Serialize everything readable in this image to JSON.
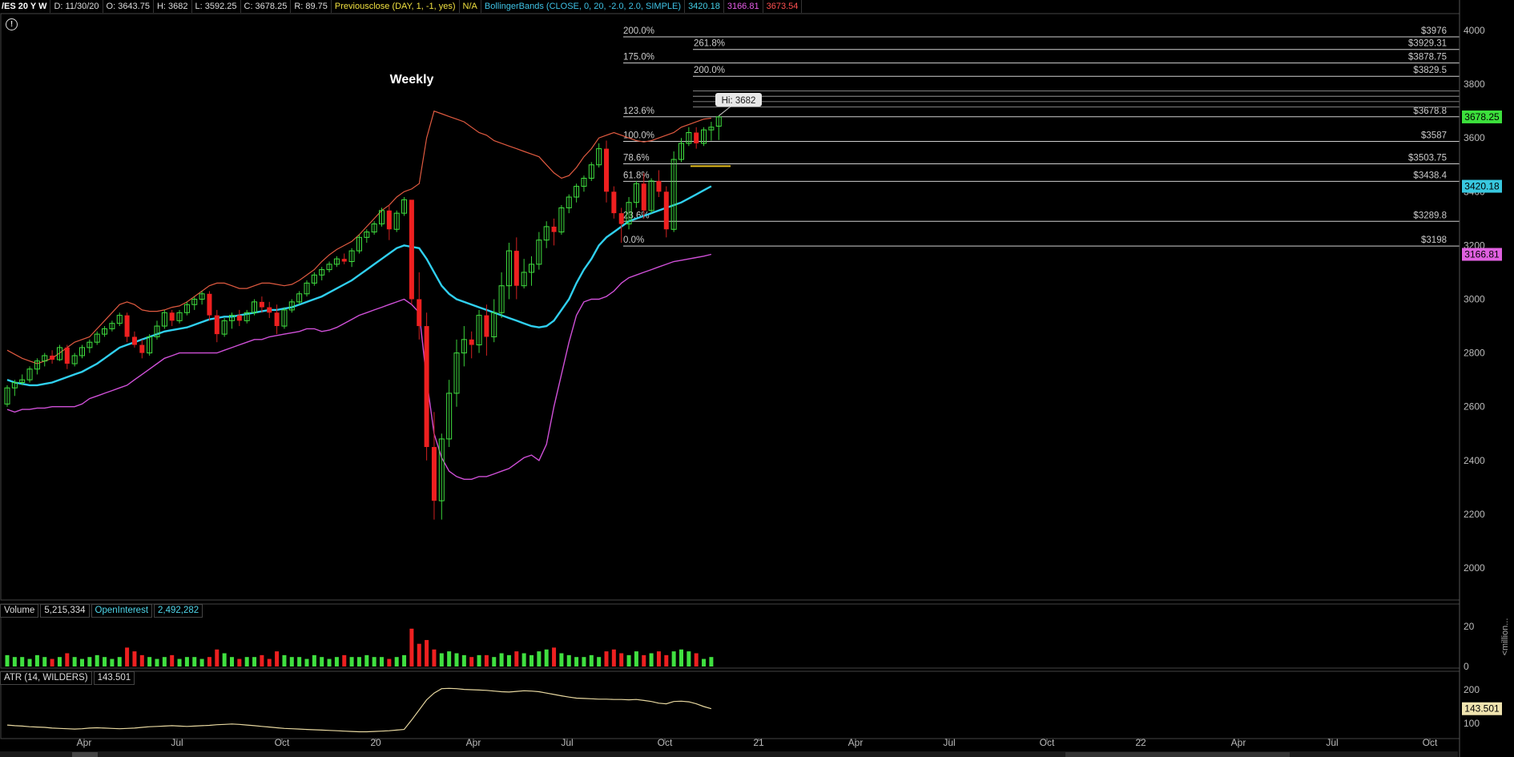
{
  "header": {
    "symbol": "/ES 20 Y W",
    "date": "D: 11/30/20",
    "open": "O: 3643.75",
    "high": "H: 3682",
    "low": "L: 3592.25",
    "close": "C: 3678.25",
    "range": "R: 89.75",
    "prevclose_label": "Previousclose (DAY, 1, -1, yes)",
    "prevclose_value": "N/A",
    "bb_label": "BollingerBands (CLOSE, 0, 20, -2.0, 2.0, SIMPLE)",
    "bb_mid": "3420.18",
    "bb_low": "3166.81",
    "bb_up": "3673.54"
  },
  "annotation": "Weekly",
  "hi_label": "Hi: 3682",
  "price_axis": {
    "ticks": [
      "4000",
      "3800",
      "3600",
      "3400",
      "3200",
      "3000",
      "2800",
      "2600",
      "2400",
      "2200",
      "2000"
    ],
    "tick_values": [
      4000,
      3800,
      3600,
      3400,
      3200,
      3000,
      2800,
      2600,
      2400,
      2200,
      2000
    ],
    "badges": [
      {
        "text": "3678.25",
        "value": 3678.25,
        "bg": "#3ce03c",
        "fg": "#000"
      },
      {
        "text": "3420.18",
        "value": 3420.18,
        "bg": "#38c8e0",
        "fg": "#000"
      },
      {
        "text": "3166.81",
        "value": 3166.81,
        "bg": "#e060e0",
        "fg": "#000"
      }
    ]
  },
  "time_axis": {
    "labels": [
      "Apr",
      "Jul",
      "Oct",
      "20",
      "Apr",
      "Jul",
      "Oct",
      "21",
      "Apr",
      "Jul",
      "Oct",
      "22",
      "Apr",
      "Jul",
      "Oct"
    ]
  },
  "fib_levels": [
    {
      "pct": "200.0%",
      "price": "$3976",
      "value": 3976,
      "set": "A"
    },
    {
      "pct": "261.8%",
      "price": "$3929.31",
      "value": 3929.31,
      "set": "B"
    },
    {
      "pct": "175.0%",
      "price": "$3878.75",
      "value": 3878.75,
      "set": "A"
    },
    {
      "pct": "200.0%",
      "price": "$3829.5",
      "value": 3829.5,
      "set": "B"
    },
    {
      "pct": "123.6%",
      "price": "$3678.8",
      "value": 3678.8,
      "set": "A"
    },
    {
      "pct": "100.0%",
      "price": "$3587",
      "value": 3587,
      "set": "A"
    },
    {
      "pct": "78.6%",
      "price": "$3503.75",
      "value": 3503.75,
      "set": "A"
    },
    {
      "pct": "61.8%",
      "price": "$3438.4",
      "value": 3438.4,
      "set": "A"
    },
    {
      "pct": "23.6%",
      "price": "$3289.8",
      "value": 3289.8,
      "set": "A"
    },
    {
      "pct": "0.0%",
      "price": "$3198",
      "value": 3198,
      "set": "A"
    }
  ],
  "volume_panel": {
    "label": "Volume",
    "value": "5,215,334",
    "oi_label": "OpenInterest",
    "oi_value": "2,492,282",
    "axis_ticks": [
      "20",
      "0"
    ],
    "axis_title": "<million..."
  },
  "atr_panel": {
    "label": "ATR (14, WILDERS)",
    "value": "143.501",
    "axis_ticks": [
      "200",
      "100"
    ],
    "badge": "143.501"
  },
  "chart_data": {
    "type": "candlestick",
    "title": "Weekly",
    "ylim": [
      1850,
      4050
    ],
    "x_weeks_start": "2019-01-07",
    "series_candles": [
      [
        2610,
        2680,
        2600,
        2670
      ],
      [
        2670,
        2700,
        2640,
        2690
      ],
      [
        2690,
        2720,
        2680,
        2700
      ],
      [
        2700,
        2750,
        2690,
        2740
      ],
      [
        2740,
        2780,
        2720,
        2770
      ],
      [
        2770,
        2800,
        2750,
        2790
      ],
      [
        2790,
        2810,
        2760,
        2775
      ],
      [
        2775,
        2830,
        2770,
        2820
      ],
      [
        2820,
        2830,
        2740,
        2760
      ],
      [
        2760,
        2800,
        2750,
        2790
      ],
      [
        2790,
        2830,
        2780,
        2820
      ],
      [
        2820,
        2850,
        2800,
        2840
      ],
      [
        2840,
        2880,
        2830,
        2870
      ],
      [
        2870,
        2900,
        2860,
        2890
      ],
      [
        2890,
        2920,
        2880,
        2910
      ],
      [
        2910,
        2950,
        2900,
        2940
      ],
      [
        2940,
        2950,
        2840,
        2860
      ],
      [
        2860,
        2880,
        2820,
        2830
      ],
      [
        2830,
        2850,
        2780,
        2800
      ],
      [
        2800,
        2870,
        2790,
        2860
      ],
      [
        2860,
        2920,
        2850,
        2900
      ],
      [
        2900,
        2960,
        2890,
        2950
      ],
      [
        2950,
        2960,
        2900,
        2920
      ],
      [
        2920,
        2960,
        2910,
        2950
      ],
      [
        2950,
        2990,
        2940,
        2980
      ],
      [
        2980,
        3010,
        2960,
        3000
      ],
      [
        3000,
        3030,
        2980,
        3020
      ],
      [
        3020,
        3030,
        2920,
        2940
      ],
      [
        2940,
        2960,
        2840,
        2870
      ],
      [
        2870,
        2930,
        2860,
        2920
      ],
      [
        2920,
        2950,
        2890,
        2940
      ],
      [
        2940,
        2960,
        2900,
        2920
      ],
      [
        2920,
        2960,
        2910,
        2950
      ],
      [
        2950,
        3000,
        2940,
        2990
      ],
      [
        2990,
        3010,
        2950,
        2970
      ],
      [
        2970,
        2990,
        2930,
        2950
      ],
      [
        2950,
        2980,
        2870,
        2900
      ],
      [
        2900,
        2970,
        2890,
        2960
      ],
      [
        2960,
        3000,
        2950,
        2990
      ],
      [
        2990,
        3030,
        2980,
        3020
      ],
      [
        3020,
        3070,
        3010,
        3060
      ],
      [
        3060,
        3100,
        3050,
        3090
      ],
      [
        3090,
        3120,
        3070,
        3110
      ],
      [
        3110,
        3140,
        3100,
        3130
      ],
      [
        3130,
        3160,
        3120,
        3150
      ],
      [
        3150,
        3170,
        3130,
        3140
      ],
      [
        3140,
        3190,
        3120,
        3180
      ],
      [
        3180,
        3240,
        3170,
        3230
      ],
      [
        3230,
        3260,
        3210,
        3250
      ],
      [
        3250,
        3290,
        3240,
        3280
      ],
      [
        3280,
        3340,
        3270,
        3330
      ],
      [
        3330,
        3350,
        3220,
        3260
      ],
      [
        3260,
        3330,
        3250,
        3320
      ],
      [
        3320,
        3380,
        3310,
        3370
      ],
      [
        3370,
        3340,
        2980,
        3000
      ],
      [
        3000,
        3100,
        2850,
        2900
      ],
      [
        2900,
        2950,
        2400,
        2450
      ],
      [
        2450,
        2580,
        2180,
        2250
      ],
      [
        2250,
        2500,
        2180,
        2480
      ],
      [
        2480,
        2700,
        2450,
        2650
      ],
      [
        2650,
        2850,
        2600,
        2800
      ],
      [
        2800,
        2900,
        2750,
        2850
      ],
      [
        2850,
        2880,
        2780,
        2830
      ],
      [
        2830,
        2960,
        2800,
        2940
      ],
      [
        2940,
        2980,
        2790,
        2860
      ],
      [
        2860,
        3000,
        2840,
        2950
      ],
      [
        2950,
        3100,
        2930,
        3050
      ],
      [
        3050,
        3210,
        3000,
        3180
      ],
      [
        3180,
        3230,
        3000,
        3050
      ],
      [
        3050,
        3150,
        3040,
        3100
      ],
      [
        3100,
        3160,
        3050,
        3130
      ],
      [
        3130,
        3250,
        3110,
        3220
      ],
      [
        3220,
        3290,
        3190,
        3270
      ],
      [
        3270,
        3300,
        3200,
        3250
      ],
      [
        3250,
        3350,
        3240,
        3340
      ],
      [
        3340,
        3390,
        3320,
        3380
      ],
      [
        3380,
        3430,
        3360,
        3420
      ],
      [
        3420,
        3460,
        3400,
        3450
      ],
      [
        3450,
        3510,
        3440,
        3500
      ],
      [
        3500,
        3580,
        3490,
        3560
      ],
      [
        3560,
        3590,
        3360,
        3400
      ],
      [
        3400,
        3420,
        3300,
        3320
      ],
      [
        3320,
        3340,
        3210,
        3280
      ],
      [
        3280,
        3380,
        3260,
        3360
      ],
      [
        3360,
        3440,
        3340,
        3430
      ],
      [
        3430,
        3470,
        3300,
        3330
      ],
      [
        3330,
        3450,
        3320,
        3440
      ],
      [
        3440,
        3480,
        3380,
        3400
      ],
      [
        3400,
        3420,
        3230,
        3260
      ],
      [
        3260,
        3550,
        3250,
        3520
      ],
      [
        3520,
        3600,
        3510,
        3580
      ],
      [
        3580,
        3640,
        3570,
        3620
      ],
      [
        3620,
        3640,
        3560,
        3580
      ],
      [
        3580,
        3640,
        3570,
        3630
      ],
      [
        3630,
        3660,
        3590,
        3640
      ],
      [
        3643.75,
        3682,
        3592.25,
        3678.25
      ]
    ],
    "bb_upper": [
      2810,
      2795,
      2780,
      2770,
      2760,
      2770,
      2780,
      2800,
      2820,
      2840,
      2850,
      2860,
      2890,
      2920,
      2950,
      2980,
      2990,
      2980,
      2960,
      2955,
      2955,
      2960,
      2970,
      2975,
      2990,
      3010,
      3030,
      3050,
      3060,
      3060,
      3050,
      3040,
      3040,
      3050,
      3060,
      3060,
      3055,
      3050,
      3055,
      3070,
      3090,
      3110,
      3140,
      3165,
      3185,
      3200,
      3215,
      3240,
      3270,
      3300,
      3330,
      3350,
      3380,
      3400,
      3410,
      3430,
      3600,
      3700,
      3690,
      3680,
      3670,
      3660,
      3640,
      3620,
      3610,
      3590,
      3580,
      3570,
      3560,
      3550,
      3540,
      3530,
      3500,
      3470,
      3450,
      3460,
      3490,
      3530,
      3560,
      3600,
      3610,
      3620,
      3610,
      3600,
      3590,
      3585,
      3590,
      3600,
      3610,
      3620,
      3640,
      3650,
      3660,
      3670,
      3673.54
    ],
    "bb_mid": [
      2700,
      2690,
      2685,
      2680,
      2680,
      2685,
      2690,
      2700,
      2710,
      2720,
      2730,
      2745,
      2760,
      2780,
      2800,
      2820,
      2830,
      2840,
      2850,
      2860,
      2870,
      2880,
      2885,
      2890,
      2895,
      2905,
      2915,
      2925,
      2930,
      2935,
      2935,
      2940,
      2945,
      2950,
      2955,
      2960,
      2960,
      2965,
      2970,
      2980,
      2990,
      3000,
      3010,
      3025,
      3040,
      3055,
      3070,
      3090,
      3110,
      3130,
      3150,
      3170,
      3190,
      3200,
      3195,
      3190,
      3150,
      3100,
      3050,
      3020,
      3000,
      2990,
      2980,
      2970,
      2960,
      2950,
      2940,
      2930,
      2920,
      2910,
      2900,
      2895,
      2900,
      2920,
      2960,
      3000,
      3060,
      3110,
      3150,
      3200,
      3230,
      3250,
      3270,
      3290,
      3300,
      3310,
      3320,
      3330,
      3340,
      3350,
      3360,
      3375,
      3390,
      3405,
      3420.18
    ],
    "bb_lower": [
      2590,
      2580,
      2590,
      2590,
      2595,
      2595,
      2600,
      2600,
      2600,
      2600,
      2610,
      2630,
      2640,
      2650,
      2660,
      2670,
      2680,
      2700,
      2720,
      2740,
      2760,
      2780,
      2790,
      2800,
      2800,
      2800,
      2800,
      2800,
      2800,
      2810,
      2820,
      2830,
      2840,
      2850,
      2850,
      2860,
      2865,
      2870,
      2875,
      2880,
      2890,
      2890,
      2880,
      2885,
      2895,
      2910,
      2925,
      2940,
      2950,
      2960,
      2970,
      2980,
      2990,
      3000,
      2980,
      2950,
      2700,
      2500,
      2410,
      2360,
      2340,
      2330,
      2330,
      2340,
      2340,
      2350,
      2360,
      2370,
      2390,
      2410,
      2420,
      2400,
      2460,
      2600,
      2720,
      2840,
      2940,
      2990,
      3000,
      3000,
      3010,
      3030,
      3060,
      3080,
      3090,
      3100,
      3110,
      3120,
      3130,
      3140,
      3145,
      3150,
      3155,
      3160,
      3166.81
    ],
    "volume": [
      6,
      5,
      5,
      4,
      6,
      5,
      4,
      5,
      7,
      5,
      4,
      5,
      6,
      5,
      4,
      5,
      10,
      8,
      6,
      5,
      4,
      5,
      6,
      4,
      5,
      5,
      4,
      5,
      9,
      7,
      5,
      4,
      5,
      5,
      6,
      4,
      8,
      6,
      5,
      5,
      4,
      6,
      5,
      4,
      5,
      6,
      5,
      5,
      6,
      5,
      5,
      4,
      5,
      6,
      20,
      12,
      14,
      9,
      7,
      8,
      7,
      6,
      5,
      6,
      6,
      5,
      7,
      6,
      8,
      7,
      6,
      8,
      9,
      10,
      7,
      6,
      5,
      5,
      6,
      5,
      8,
      9,
      7,
      6,
      8,
      6,
      7,
      8,
      6,
      8,
      9,
      8,
      7,
      4,
      5
    ],
    "atr": [
      95,
      93,
      92,
      90,
      89,
      88,
      86,
      85,
      84,
      83,
      84,
      86,
      87,
      86,
      85,
      84,
      85,
      86,
      88,
      90,
      91,
      92,
      93,
      92,
      91,
      92,
      93,
      94,
      96,
      97,
      98,
      97,
      95,
      93,
      91,
      89,
      87,
      85,
      84,
      83,
      82,
      81,
      80,
      79,
      78,
      77,
      76,
      75,
      75,
      76,
      77,
      78,
      80,
      82,
      110,
      140,
      170,
      190,
      203,
      204,
      203,
      201,
      200,
      199,
      198,
      196,
      194,
      193,
      195,
      197,
      196,
      194,
      190,
      186,
      182,
      178,
      175,
      174,
      173,
      172,
      172,
      171,
      171,
      170,
      171,
      168,
      165,
      160,
      158,
      165,
      166,
      164,
      158,
      150,
      143.501
    ]
  }
}
